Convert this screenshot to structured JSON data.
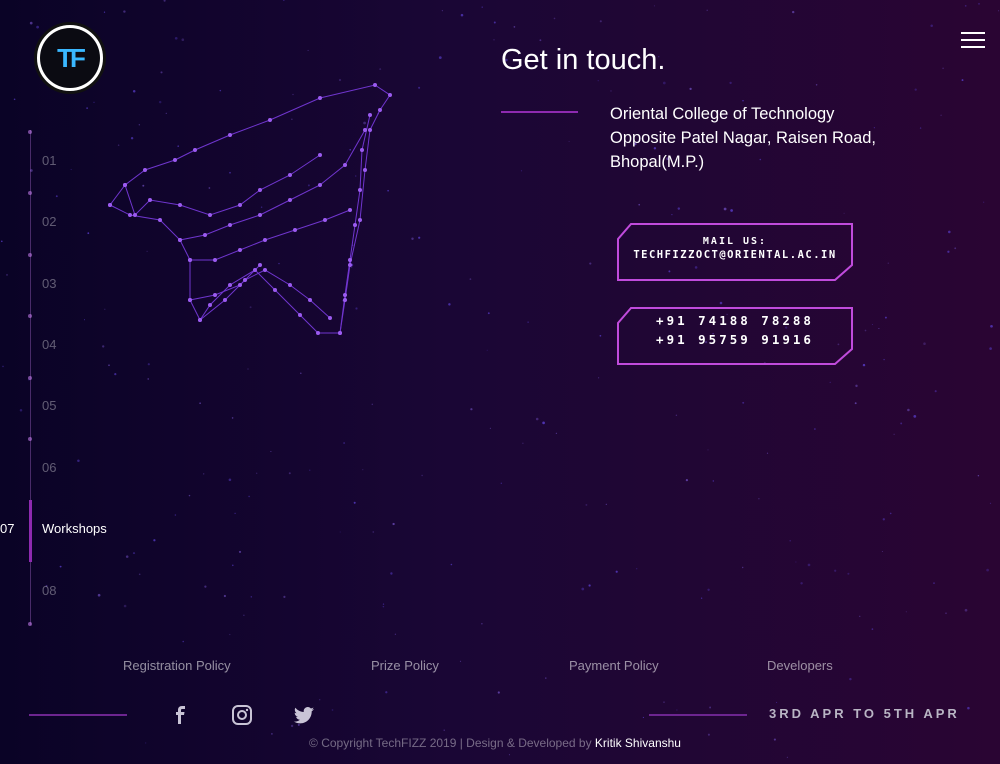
{
  "nav": {
    "items": [
      {
        "num": "01"
      },
      {
        "num": "02"
      },
      {
        "num": "03"
      },
      {
        "num": "04"
      },
      {
        "num": "05"
      },
      {
        "num": "06"
      },
      {
        "num": "08"
      }
    ],
    "active": {
      "num": "07",
      "label": "Workshops"
    }
  },
  "contact": {
    "title": "Get in touch.",
    "address": [
      "Oriental College of Technology",
      "Opposite Patel Nagar, Raisen Road,",
      "Bhopal(M.P.)"
    ],
    "mail_label": "MAIL US:",
    "mail_value": "TECHFIZZOCT@ORIENTAL.AC.IN",
    "phones": [
      "+91 74188 78288",
      "+91 95759 91916"
    ]
  },
  "footer": {
    "policies": [
      "Registration Policy",
      "Prize Policy",
      "Payment Policy",
      "Developers"
    ],
    "social": [
      "facebook-icon",
      "instagram-icon",
      "twitter-icon"
    ],
    "dates": "3RD APR TO 5TH APR",
    "copyright_prefix": "© Copyright TechFIZZ 2019  |  Design & Developed by ",
    "author": "Kritik Shivanshu"
  },
  "colors": {
    "accent": "#8e2ab0",
    "box_border": "#c04bdc",
    "graphic": "#8a3fe0"
  }
}
